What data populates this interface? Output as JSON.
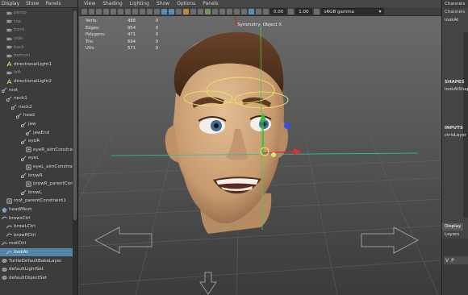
{
  "outliner": {
    "menu": [
      "Display",
      "Show",
      "Panels"
    ],
    "items": [
      {
        "label": "persp",
        "depth": 1,
        "kind": "camera",
        "dim": true
      },
      {
        "label": "top",
        "depth": 1,
        "kind": "camera",
        "dim": true
      },
      {
        "label": "front",
        "depth": 1,
        "kind": "camera",
        "dim": true
      },
      {
        "label": "side",
        "depth": 1,
        "kind": "camera",
        "dim": true
      },
      {
        "label": "back",
        "depth": 1,
        "kind": "camera",
        "dim": true
      },
      {
        "label": "bottom",
        "depth": 1,
        "kind": "camera",
        "dim": true
      },
      {
        "label": "directionalLight1",
        "depth": 1,
        "kind": "light"
      },
      {
        "label": "left",
        "depth": 1,
        "kind": "camera",
        "dim": true
      },
      {
        "label": "directionalLight2",
        "depth": 1,
        "kind": "light"
      },
      {
        "label": "root",
        "depth": 0,
        "kind": "joint"
      },
      {
        "label": "neck1",
        "depth": 1,
        "kind": "joint"
      },
      {
        "label": "neck2",
        "depth": 2,
        "kind": "joint"
      },
      {
        "label": "head",
        "depth": 3,
        "kind": "joint"
      },
      {
        "label": "jaw",
        "depth": 4,
        "kind": "joint"
      },
      {
        "label": "jawEnd",
        "depth": 5,
        "kind": "joint"
      },
      {
        "label": "eyeR",
        "depth": 4,
        "kind": "joint"
      },
      {
        "label": "eyeR_aimConstraint1",
        "depth": 5,
        "kind": "constraint"
      },
      {
        "label": "eyeL",
        "depth": 4,
        "kind": "joint"
      },
      {
        "label": "eyeL_aimConstraint1",
        "depth": 5,
        "kind": "constraint"
      },
      {
        "label": "browR",
        "depth": 4,
        "kind": "joint"
      },
      {
        "label": "browR_parentConstrai",
        "depth": 5,
        "kind": "constraint"
      },
      {
        "label": "browL",
        "depth": 4,
        "kind": "joint"
      },
      {
        "label": "root_parentConstraint1",
        "depth": 1,
        "kind": "constraint"
      },
      {
        "label": "headMesh",
        "depth": 0,
        "kind": "mesh"
      },
      {
        "label": "browsCtrl",
        "depth": 0,
        "kind": "curve"
      },
      {
        "label": "browLCtrl",
        "depth": 1,
        "kind": "curve"
      },
      {
        "label": "browRCtrl",
        "depth": 1,
        "kind": "curve"
      },
      {
        "label": "rootCtrl",
        "depth": 0,
        "kind": "curve"
      },
      {
        "label": "lookAt",
        "depth": 1,
        "kind": "curve",
        "selected": true
      },
      {
        "label": "TurtleDefaultBakeLayer",
        "depth": 0,
        "kind": "set"
      },
      {
        "label": "defaultLightSet",
        "depth": 0,
        "kind": "set"
      },
      {
        "label": "defaultObjectSet",
        "depth": 0,
        "kind": "set"
      }
    ]
  },
  "viewport": {
    "menu": [
      "View",
      "Shading",
      "Lighting",
      "Show",
      "Options",
      "Panels"
    ],
    "toolbar": {
      "gamma_value": "0.00",
      "exposure_value": "1.00",
      "color_space": "sRGB gamma"
    },
    "hud": [
      {
        "label": "Verts:",
        "a": "488",
        "b": "0"
      },
      {
        "label": "Edges:",
        "a": "954",
        "b": "0"
      },
      {
        "label": "Polygons:",
        "a": "471",
        "b": "0"
      },
      {
        "label": "Tris:",
        "a": "694",
        "b": "0"
      },
      {
        "label": "UVs:",
        "a": "571",
        "b": "0"
      }
    ],
    "symmetry": "Symmetry: Object X",
    "colors": {
      "skin": "#d2a97f",
      "hair": "#5b3a24",
      "selection": "#e8e06a",
      "axis_x": "#e03030",
      "axis_y": "#30c030",
      "axis_z": "#3050e0"
    }
  },
  "channel_box": {
    "header": "Channels",
    "object_name": "lookAt",
    "shapes_label": "SHAPES",
    "shape_name": "lookAtShape",
    "inputs_label": "INPUTS",
    "input_name": "ctrlsLayer",
    "tabs": [
      "Display"
    ],
    "layers_label": "Layers",
    "layer_flags": [
      "V",
      "P"
    ]
  }
}
